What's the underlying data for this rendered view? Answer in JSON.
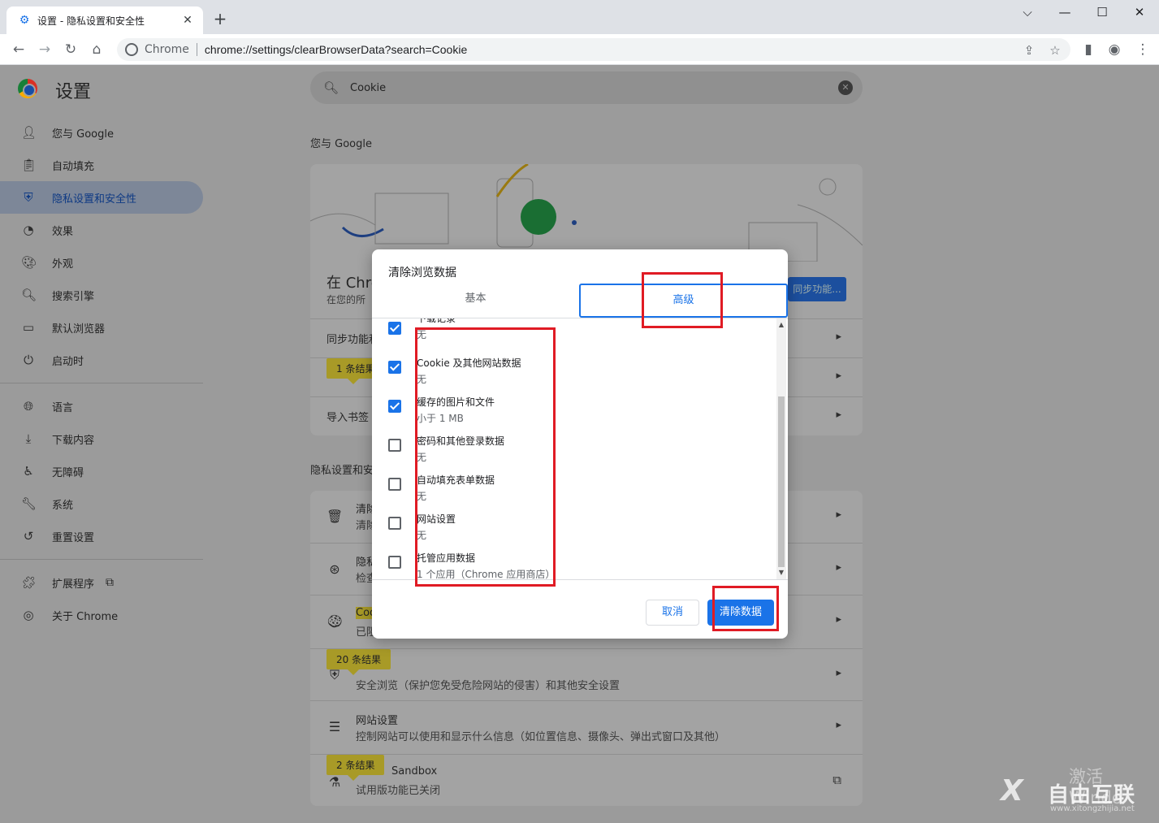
{
  "tab": {
    "title": "设置 - 隐私设置和安全性",
    "close": "✕",
    "new_tab": "+"
  },
  "window_controls": {
    "dropdown": "⌵",
    "minimize": "—",
    "maximize": "☐",
    "close": "✕"
  },
  "omnibox": {
    "site": "Chrome",
    "url": "chrome://settings/clearBrowserData?search=Cookie"
  },
  "settings": {
    "app_title": "设置",
    "search_query": "Cookie",
    "nav": [
      {
        "label": "您与 Google",
        "icon": "person-icon"
      },
      {
        "label": "自动填充",
        "icon": "clipboard-icon"
      },
      {
        "label": "隐私设置和安全性",
        "icon": "shield-icon"
      },
      {
        "label": "效果",
        "icon": "speedometer-icon"
      },
      {
        "label": "外观",
        "icon": "palette-icon"
      },
      {
        "label": "搜索引擎",
        "icon": "search-icon"
      },
      {
        "label": "默认浏览器",
        "icon": "browser-icon"
      },
      {
        "label": "启动时",
        "icon": "power-icon"
      },
      {
        "label": "语言",
        "icon": "globe-icon"
      },
      {
        "label": "下载内容",
        "icon": "download-icon"
      },
      {
        "label": "无障碍",
        "icon": "accessibility-icon"
      },
      {
        "label": "系统",
        "icon": "wrench-icon"
      },
      {
        "label": "重置设置",
        "icon": "history-icon"
      },
      {
        "label": "扩展程序",
        "icon": "puzzle-icon"
      },
      {
        "label": "关于 Chrome",
        "icon": "chrome-icon"
      }
    ],
    "section_you_google": "您与 Google",
    "card1": {
      "heading_partial": "在 Chro",
      "sub_partial": "在您的所",
      "sync_button_partial": "同步功能...",
      "row1": "同步功能和",
      "row3": "导入书签"
    },
    "section_privacy_partial": "隐私设置和安",
    "privacy_rows": {
      "clear_t": "清除",
      "clear_s": "清除",
      "check_t": "隐私",
      "check_s": "检查",
      "cookie_t": "Coo",
      "cookie_s": "已阻",
      "safe_s": "安全浏览（保护您免受危险网站的侵害）和其他安全设置",
      "site_t": "网站设置",
      "site_s": "控制网站可以使用和显示什么信息（如位置信息、摄像头、弹出式窗口及其他）",
      "sandbox_t": "Sandbox",
      "sandbox_s": "试用版功能已关闭"
    },
    "badges": {
      "b1": "1 条结果",
      "b2": "20 条结果",
      "b3": "2 条结果"
    }
  },
  "dialog": {
    "title": "清除浏览数据",
    "tab_basic": "基本",
    "tab_advanced": "高级",
    "items": [
      {
        "title": "下载记录",
        "subtitle": "无",
        "checked": true
      },
      {
        "title": "Cookie 及其他网站数据",
        "subtitle": "无",
        "checked": true
      },
      {
        "title": "缓存的图片和文件",
        "subtitle": "小于 1 MB",
        "checked": true
      },
      {
        "title": "密码和其他登录数据",
        "subtitle": "无",
        "checked": false
      },
      {
        "title": "自动填充表单数据",
        "subtitle": "无",
        "checked": false
      },
      {
        "title": "网站设置",
        "subtitle": "无",
        "checked": false
      },
      {
        "title": "托管应用数据",
        "subtitle": "1 个应用（Chrome 应用商店）",
        "checked": false
      }
    ],
    "cancel": "取消",
    "clear": "清除数据"
  },
  "watermark": {
    "line1": "激活 Windo",
    "brand": "自由互联",
    "sub": "www.xitongzhijia.net"
  }
}
